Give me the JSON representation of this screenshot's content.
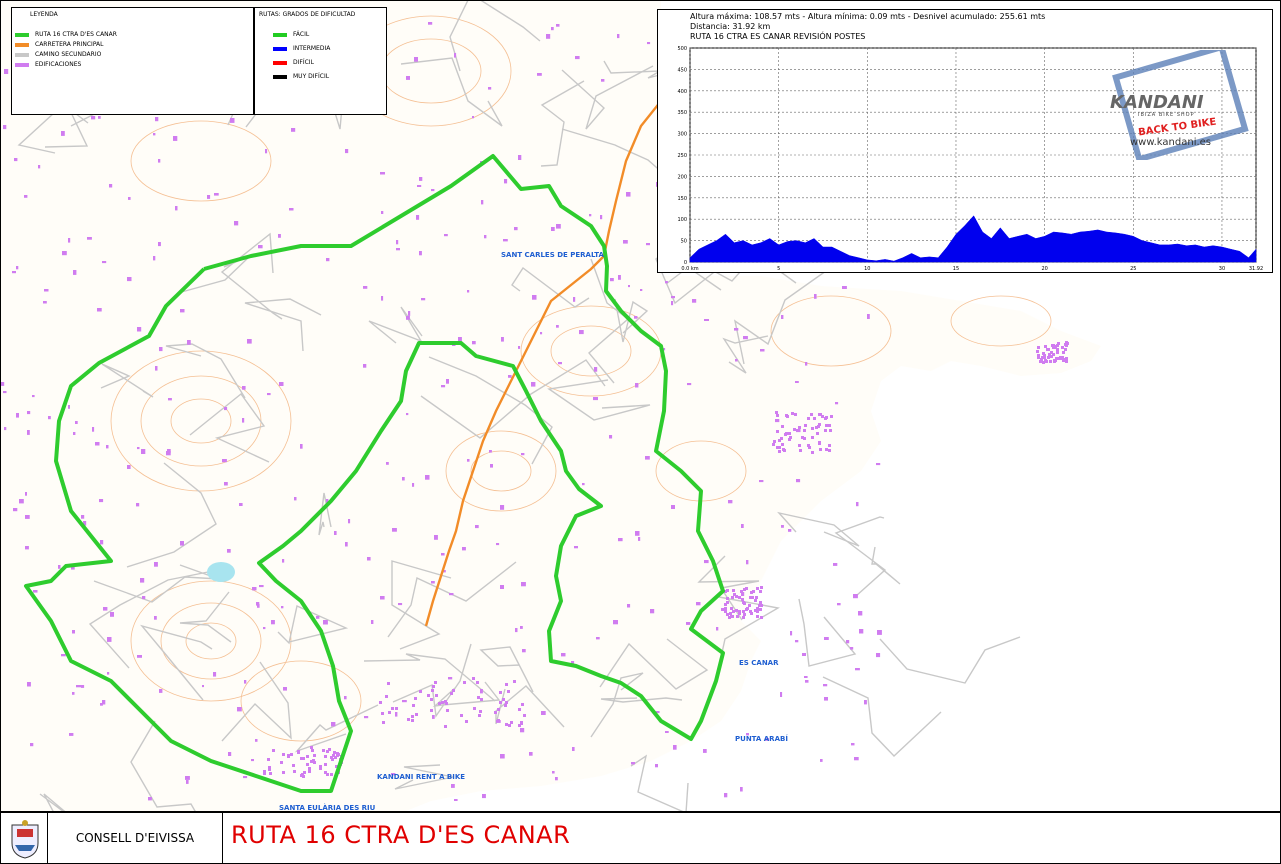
{
  "legend": {
    "title": "LEYENDA",
    "items": [
      {
        "label": "RUTA 16 CTRA D'ES CANAR",
        "color": "#2ecc2e"
      },
      {
        "label": "CARRETERA PRINCIPAL",
        "color": "#f28c28"
      },
      {
        "label": "CAMINO SECUNDARIO",
        "color": "#c8c8c8"
      },
      {
        "label": "EDIFICACIONES",
        "color": "#d07cf0"
      }
    ]
  },
  "difficulty": {
    "title": "RUTAS: GRADOS DE DIFICULTAD",
    "items": [
      {
        "label": "FÁCIL",
        "color": "#22cc22"
      },
      {
        "label": "INTERMEDIA",
        "color": "#0000ff"
      },
      {
        "label": "DIFÍCIL",
        "color": "#ff0000"
      },
      {
        "label": "MUY DIFÍCIL",
        "color": "#000000"
      }
    ]
  },
  "profile": {
    "stats": "Altura máxima: 108.57 mts - Altura mínima: 0.09 mts - Desnivel acumulado: 255.61 mts",
    "distance": "Distancia: 31.92 km",
    "title": "RUTA 16 CTRA ES CANAR REVISIÓN POSTES",
    "logo": {
      "brand": "KANDANI",
      "sub": "IBIZA BIKE SHOP",
      "slogan": "BACK TO BIKE",
      "url": "www.kandani.es"
    },
    "chart_data": {
      "type": "area",
      "title": "RUTA 16 CTRA ES CANAR REVISIÓN POSTES",
      "xlabel": "",
      "ylabel": "",
      "xlim": [
        0,
        31.92
      ],
      "ylim": [
        0,
        500
      ],
      "x_ticks": [
        "0.0 km",
        "5",
        "10",
        "15",
        "20",
        "25",
        "30",
        "31.92"
      ],
      "x_tick_values": [
        0,
        5,
        10,
        15,
        20,
        25,
        30,
        31.92
      ],
      "y_ticks": [
        "0",
        "50",
        "100",
        "150",
        "200",
        "250",
        "300",
        "350",
        "400",
        "450",
        "500"
      ],
      "y_tick_values": [
        0,
        50,
        100,
        150,
        200,
        250,
        300,
        350,
        400,
        450,
        500
      ],
      "grid": true,
      "color": "#0000ee",
      "series": [
        {
          "x": [
            0,
            0.5,
            1,
            1.5,
            2,
            2.5,
            3,
            3.5,
            4,
            4.5,
            5,
            5.5,
            6,
            6.5,
            7,
            7.5,
            8,
            8.5,
            9,
            9.5,
            10,
            10.5,
            11,
            11.5,
            12,
            12.5,
            13,
            13.5,
            14,
            14.5,
            15,
            15.5,
            16,
            16.5,
            17,
            17.5,
            18,
            18.5,
            19,
            19.5,
            20,
            20.5,
            21,
            21.5,
            22,
            22.5,
            23,
            23.5,
            24,
            24.5,
            25,
            25.5,
            26,
            26.5,
            27,
            27.5,
            28,
            28.5,
            29,
            29.5,
            30,
            30.5,
            31,
            31.5,
            31.92
          ],
          "y": [
            10,
            30,
            40,
            50,
            65,
            45,
            50,
            40,
            45,
            55,
            40,
            48,
            50,
            45,
            55,
            35,
            35,
            25,
            15,
            10,
            5,
            3,
            6,
            2,
            10,
            20,
            10,
            12,
            10,
            35,
            65,
            85,
            108,
            70,
            55,
            80,
            55,
            60,
            65,
            55,
            60,
            70,
            68,
            65,
            70,
            72,
            75,
            70,
            68,
            65,
            60,
            50,
            45,
            40,
            40,
            42,
            38,
            40,
            35,
            38,
            35,
            30,
            25,
            10,
            30
          ]
        }
      ]
    }
  },
  "places": [
    {
      "name": "SANT CARLES DE PERALTA",
      "x": 500,
      "y": 250
    },
    {
      "name": "ES CANAR",
      "x": 738,
      "y": 658
    },
    {
      "name": "PUNTA ARABÍ",
      "x": 734,
      "y": 734
    },
    {
      "name": "KANDANI RENT A BIKE",
      "x": 376,
      "y": 772
    },
    {
      "name": "SANTA EULÀRIA DES RIU",
      "x": 278,
      "y": 803
    }
  ],
  "footer": {
    "org": "CONSELL D'EIVISSA",
    "title": "RUTA 16 CTRA D'ES CANAR"
  },
  "colors": {
    "route": "#2ecc2e",
    "road": "#f28c28",
    "path": "#c8c8c8",
    "buildings": "#d07cf0",
    "contour": "#f2b07a",
    "sea": "#ffffff",
    "place_label": "#1f5fd1",
    "title_red": "#e00000"
  }
}
